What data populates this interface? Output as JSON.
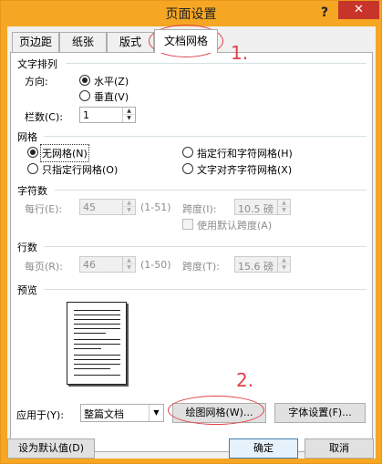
{
  "window": {
    "title": "页面设置",
    "help": "?",
    "close": "✕"
  },
  "tabs": [
    {
      "label": "页边距",
      "active": false
    },
    {
      "label": "纸张",
      "active": false
    },
    {
      "label": "版式",
      "active": false
    },
    {
      "label": "文档网格",
      "active": true
    }
  ],
  "text_direction": {
    "group_label": "文字排列",
    "direction_label": "方向:",
    "horizontal": "水平(Z)",
    "vertical": "垂直(V)",
    "columns_label": "栏数(C):",
    "columns_value": "1"
  },
  "grid": {
    "group_label": "网格",
    "no_grid": "无网格(N)",
    "specify_line_and_char": "指定行和字符网格(H)",
    "specify_line_only": "只指定行网格(O)",
    "snap_to_char_grid": "文字对齐字符网格(X)"
  },
  "characters": {
    "group_label": "字符数",
    "per_line_label": "每行(E):",
    "per_line_value": "45",
    "per_line_range": "(1-51)",
    "pitch_label": "跨度(I):",
    "pitch_value": "10.5 磅",
    "use_default_pitch": "使用默认跨度(A)"
  },
  "lines": {
    "group_label": "行数",
    "per_page_label": "每页(R):",
    "per_page_value": "46",
    "per_page_range": "(1-50)",
    "pitch_label": "跨度(T):",
    "pitch_value": "15.6 磅"
  },
  "preview": {
    "group_label": "预览"
  },
  "apply": {
    "label": "应用于(Y):",
    "value": "整篇文档",
    "drawing_grid_button": "绘图网格(W)...",
    "font_settings_button": "字体设置(F)..."
  },
  "footer": {
    "set_default": "设为默认值(D)",
    "ok": "确定",
    "cancel": "取消"
  },
  "annotations": {
    "step1": "1.",
    "step2": "2."
  },
  "colors": {
    "titlebar": "#f5a623",
    "close": "#c7342a",
    "annotation": "#e0424a"
  }
}
